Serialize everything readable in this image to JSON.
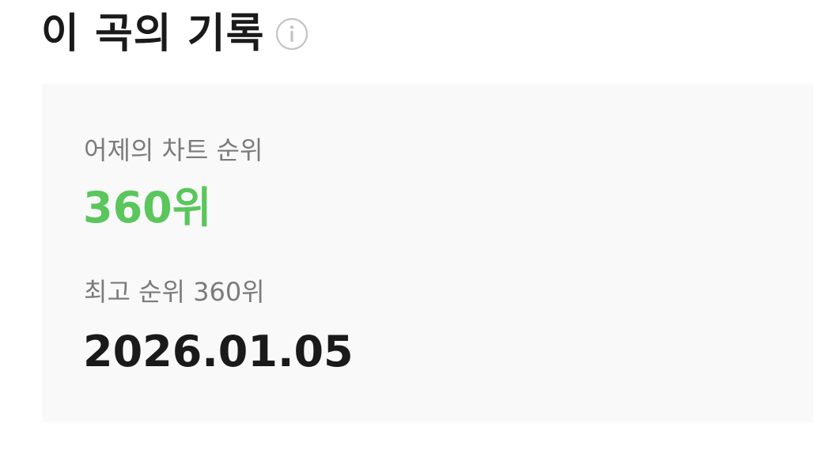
{
  "section": {
    "title": "이 곡의 기록",
    "info_icon": "info-circle-icon"
  },
  "record": {
    "yesterday_label": "어제의 차트 순위",
    "yesterday_rank": "360위",
    "best_label": "최고 순위 360위",
    "best_date": "2026.01.05"
  },
  "colors": {
    "rank_accent": "#5ac65c",
    "card_background": "#f9f9f9",
    "label_gray": "#7b7b7b",
    "title_dark": "#1a1a1a"
  }
}
